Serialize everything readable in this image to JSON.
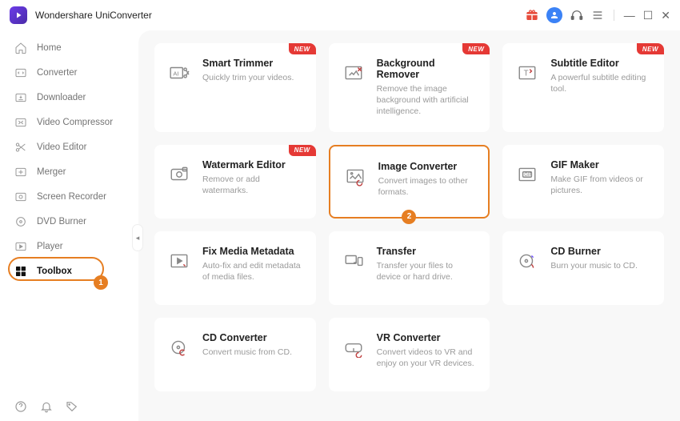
{
  "app": {
    "name": "Wondershare UniConverter"
  },
  "titlebar": {
    "iconOrder": [
      "gift",
      "user",
      "headset",
      "menu",
      "sep",
      "min",
      "max",
      "close"
    ]
  },
  "sidebar": {
    "items": [
      {
        "id": "home",
        "label": "Home",
        "icon": "home"
      },
      {
        "id": "converter",
        "label": "Converter",
        "icon": "converter"
      },
      {
        "id": "downloader",
        "label": "Downloader",
        "icon": "download"
      },
      {
        "id": "video-compressor",
        "label": "Video Compressor",
        "icon": "compress"
      },
      {
        "id": "video-editor",
        "label": "Video Editor",
        "icon": "scissors"
      },
      {
        "id": "merger",
        "label": "Merger",
        "icon": "merge"
      },
      {
        "id": "screen-recorder",
        "label": "Screen Recorder",
        "icon": "record"
      },
      {
        "id": "dvd-burner",
        "label": "DVD Burner",
        "icon": "dvd"
      },
      {
        "id": "player",
        "label": "Player",
        "icon": "play"
      },
      {
        "id": "toolbox",
        "label": "Toolbox",
        "icon": "grid",
        "active": true
      }
    ],
    "activeBadge": "1"
  },
  "toolbox": {
    "cards": [
      {
        "id": "smart-trimmer",
        "title": "Smart Trimmer",
        "desc": "Quickly trim your videos.",
        "icon": "trimmer",
        "new": true
      },
      {
        "id": "background-remover",
        "title": "Background Remover",
        "desc": "Remove the image background with artificial intelligence.",
        "icon": "bgremove",
        "new": true
      },
      {
        "id": "subtitle-editor",
        "title": "Subtitle Editor",
        "desc": "A powerful subtitle editing tool.",
        "icon": "subtitle",
        "new": true
      },
      {
        "id": "watermark-editor",
        "title": "Watermark Editor",
        "desc": "Remove or add watermarks.",
        "icon": "watermark",
        "new": true
      },
      {
        "id": "image-converter",
        "title": "Image Converter",
        "desc": "Convert images to other formats.",
        "icon": "imgconv",
        "highlighted": true,
        "badge": "2"
      },
      {
        "id": "gif-maker",
        "title": "GIF Maker",
        "desc": "Make GIF from videos or pictures.",
        "icon": "gif"
      },
      {
        "id": "fix-media-metadata",
        "title": "Fix Media Metadata",
        "desc": "Auto-fix and edit metadata of media files.",
        "icon": "metadata"
      },
      {
        "id": "transfer",
        "title": "Transfer",
        "desc": "Transfer your files to device or hard drive.",
        "icon": "transfer"
      },
      {
        "id": "cd-burner",
        "title": "CD Burner",
        "desc": "Burn your music to CD.",
        "icon": "cdburn"
      },
      {
        "id": "cd-converter",
        "title": "CD Converter",
        "desc": "Convert music from CD.",
        "icon": "cdconv"
      },
      {
        "id": "vr-converter",
        "title": "VR Converter",
        "desc": "Convert videos to VR and enjoy on your VR devices.",
        "icon": "vr"
      }
    ],
    "newLabel": "NEW"
  },
  "badges": {
    "new": "NEW"
  }
}
